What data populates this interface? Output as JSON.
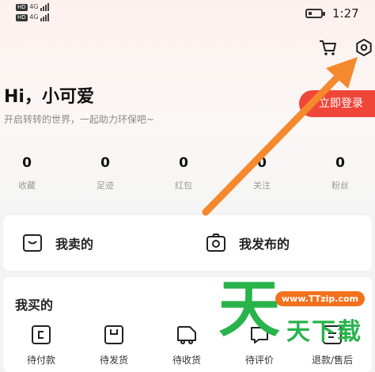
{
  "status_bar": {
    "sim1": "HD",
    "sim1_net": "4G",
    "sim2": "HD",
    "sim2_net": "4G",
    "time": "1:27"
  },
  "header": {
    "cart_icon": "shopping-cart-icon",
    "settings_icon": "settings-hexagon-icon"
  },
  "profile": {
    "greeting": "Hi，小可爱",
    "subtitle": "开启转转的世界，一起助力环保吧~",
    "login_button": "立即登录"
  },
  "stats": [
    {
      "value": "0",
      "label": "收藏"
    },
    {
      "value": "0",
      "label": "足迹"
    },
    {
      "value": "0",
      "label": "红包"
    },
    {
      "value": "0",
      "label": "关注"
    },
    {
      "value": "0",
      "label": "粉丝"
    }
  ],
  "sell_section": {
    "my_sold": "我卖的",
    "my_posted": "我发布的"
  },
  "buy_section": {
    "title": "我买的",
    "orders": [
      {
        "label": "待付款",
        "icon": "wallet-icon"
      },
      {
        "label": "待发货",
        "icon": "box-icon"
      },
      {
        "label": "待收货",
        "icon": "truck-icon"
      },
      {
        "label": "待评价",
        "icon": "comment-icon"
      },
      {
        "label": "退款/售后",
        "icon": "refund-icon"
      }
    ]
  },
  "watermark": {
    "big_char": "天",
    "url": "www.TTzip.com",
    "sub_text": "天下载"
  },
  "colors": {
    "accent_red": "#f0463a",
    "arrow_orange": "#f5892e",
    "watermark_green": "#28b34b",
    "watermark_orange": "#f2711c"
  }
}
